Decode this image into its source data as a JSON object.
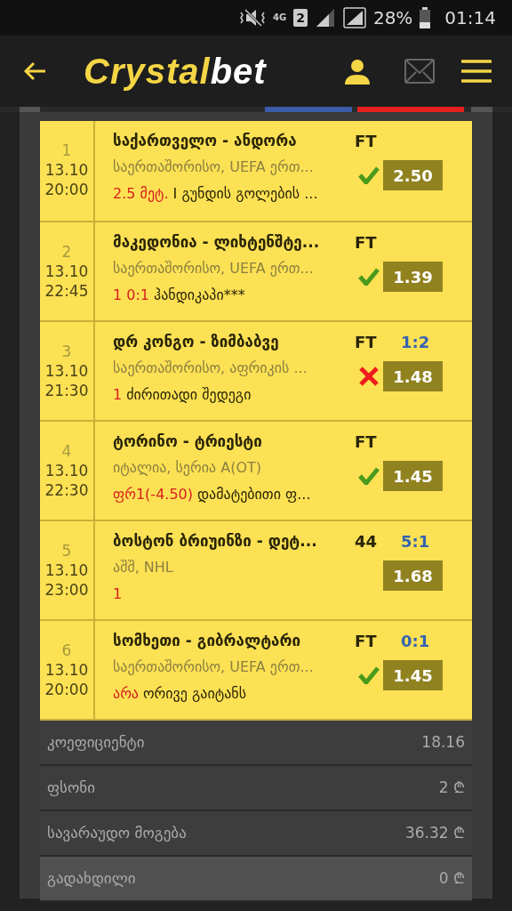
{
  "status_bar": {
    "battery": "28%",
    "time": "01:14",
    "network": "4G",
    "sim": "2"
  },
  "header": {
    "logo_primary": "Crystal",
    "logo_secondary": "bet"
  },
  "bets": [
    {
      "number": "1",
      "date": "13.10",
      "time": "20:00",
      "match": "საქართველო - ანდორა",
      "status": "FT",
      "league": "საერთაშორისო, UEFA ერთ...",
      "pick": "2.5 მეტ.",
      "market": "I გუნდის გოლების ...",
      "odds": "2.50",
      "won": true,
      "lost": false
    },
    {
      "number": "2",
      "date": "13.10",
      "time": "22:45",
      "match": "მაკედონია - ლიხტენშტე...",
      "status": "FT",
      "league": "საერთაშორისო, UEFA ერთ...",
      "pick": "1 0:1",
      "market": "ჰანდიკაპი***",
      "odds": "1.39",
      "won": true,
      "lost": false
    },
    {
      "number": "3",
      "date": "13.10",
      "time": "21:30",
      "match": "დრ კონგო - ზიმბაბვე",
      "status": "FT",
      "score": "1:2",
      "league": "საერთაშორისო, აფრიკის ...",
      "pick": "1",
      "market": "ძირითადი შედეგი",
      "odds": "1.48",
      "won": false,
      "lost": true
    },
    {
      "number": "4",
      "date": "13.10",
      "time": "22:30",
      "match": "ტორინო - ტრიესტი",
      "status": "FT",
      "league": "იტალია, სერია A(OT)",
      "pick": "ფრ1(-4.50)",
      "market": "დამატებითი ფ...",
      "odds": "1.45",
      "won": true,
      "lost": false
    },
    {
      "number": "5",
      "date": "13.10",
      "time": "23:00",
      "match": "ბოსტონ ბრიუინზი - დეტ...",
      "status": "44",
      "score": "5:1",
      "league": "აშშ, NHL",
      "pick": "1",
      "odds": "1.68",
      "won": false,
      "lost": false
    },
    {
      "number": "6",
      "date": "13.10",
      "time": "20:00",
      "match": "სომხეთი - გიბრალტარი",
      "status": "FT",
      "score": "0:1",
      "league": "საერთაშორისო, UEFA ერთ...",
      "pick": "არა",
      "market": "ორივე გაიტანს",
      "odds": "1.45",
      "won": true,
      "lost": false
    }
  ],
  "summary": [
    {
      "label": "კოეფიციენტი",
      "value": "18.16",
      "highlighted": false
    },
    {
      "label": "ფსონი",
      "value": "2",
      "currency": "₾",
      "highlighted": false
    },
    {
      "label": "სავარაუდო მოგება",
      "value": "36.32",
      "currency": "₾",
      "highlighted": false
    },
    {
      "label": "გადახდილი",
      "value": "0",
      "currency": "₾",
      "highlighted": true
    }
  ]
}
